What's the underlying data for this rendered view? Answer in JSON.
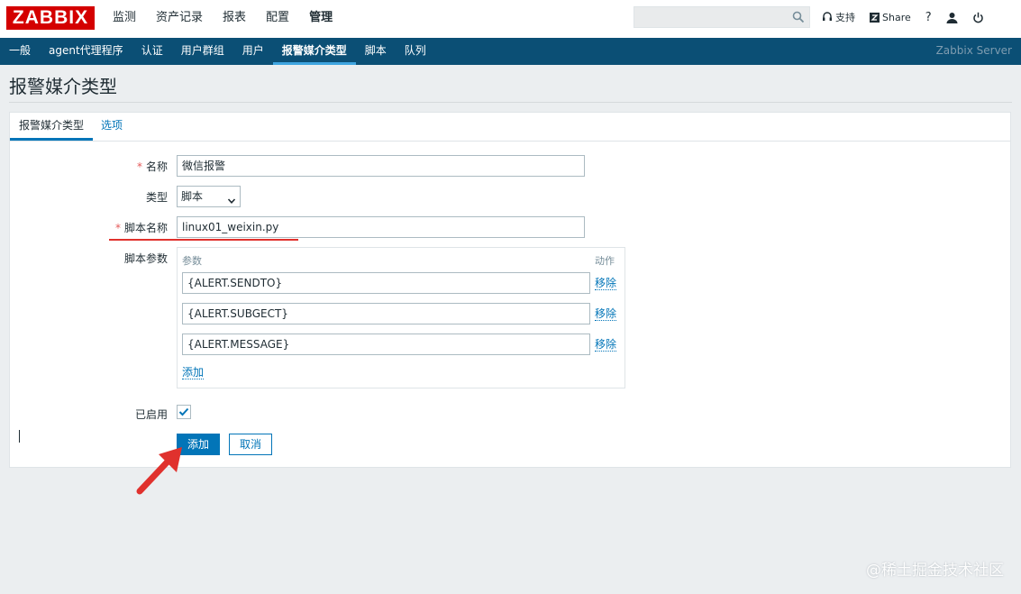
{
  "logo": "ZABBIX",
  "main_nav": [
    "监测",
    "资产记录",
    "报表",
    "配置",
    "管理"
  ],
  "main_nav_active": "管理",
  "search": {
    "value": "",
    "placeholder": ""
  },
  "top_links": {
    "support": "支持",
    "share": "Share",
    "help": "?"
  },
  "sub_nav": [
    "一般",
    "agent代理程序",
    "认证",
    "用户群组",
    "用户",
    "报警媒介类型",
    "脚本",
    "队列"
  ],
  "sub_nav_active": "报警媒介类型",
  "server_name": "Zabbix Server",
  "page_title": "报警媒介类型",
  "tabs": [
    "报警媒介类型",
    "选项"
  ],
  "form": {
    "name_label": "名称",
    "name_value": "微信报警",
    "type_label": "类型",
    "type_value": "脚本",
    "script_name_label": "脚本名称",
    "script_name_value": "linux01_weixin.py",
    "params_label": "脚本参数",
    "params_header_param": "参数",
    "params_header_action": "动作",
    "params": [
      {
        "value": "{ALERT.SENDTO}",
        "action": "移除"
      },
      {
        "value": "{ALERT.SUBGECT}",
        "action": "移除"
      },
      {
        "value": "{ALERT.MESSAGE}",
        "action": "移除"
      }
    ],
    "add_param": "添加",
    "enabled_label": "已启用",
    "enabled": true,
    "submit_label": "添加",
    "cancel_label": "取消"
  },
  "required_mark": "*",
  "colors": {
    "nav_bar": "#0b4f75",
    "accent": "#0275b8",
    "logo": "#d40000",
    "annotation": "#e0312d"
  },
  "watermark": "@稀土掘金技术社区"
}
